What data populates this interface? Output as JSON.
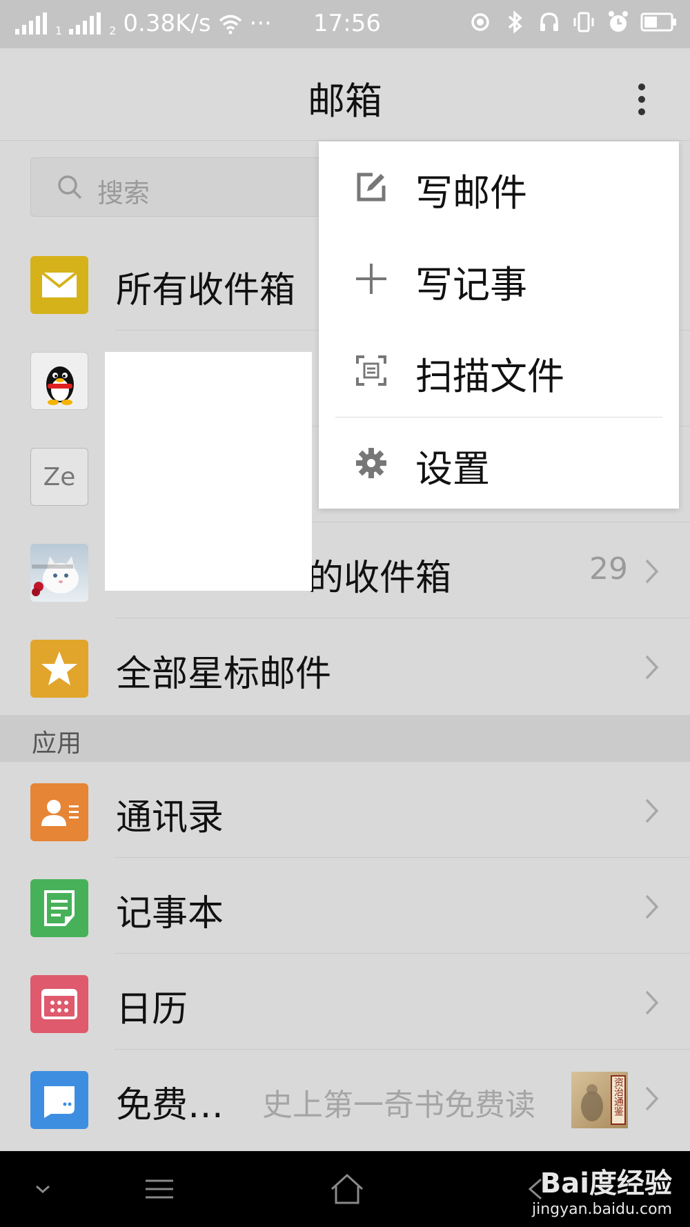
{
  "status_bar": {
    "sim1": "1",
    "sim2": "2",
    "speed": "0.38K/s",
    "dots": "···",
    "time": "17:56"
  },
  "header": {
    "title": "邮箱"
  },
  "search": {
    "placeholder": "搜索"
  },
  "mailboxes": [
    {
      "label": "所有收件箱",
      "icon": "mail-icon",
      "color": "#d6b21a"
    },
    {
      "label": "",
      "icon": "qq-penguin-avatar"
    },
    {
      "label": "",
      "icon": "ze-avatar",
      "icon_text": "Ze"
    },
    {
      "label": "的收件箱",
      "icon": "kitten-avatar",
      "count": "29"
    },
    {
      "label": "全部星标邮件",
      "icon": "star-icon",
      "color": "#e2a52c"
    }
  ],
  "section": {
    "title": "应用"
  },
  "apps": [
    {
      "label": "通讯录",
      "icon": "contacts-icon",
      "color": "#e68535"
    },
    {
      "label": "记事本",
      "icon": "notepad-icon",
      "color": "#47b15a"
    },
    {
      "label": "日历",
      "icon": "calendar-icon",
      "color": "#de5a6c"
    },
    {
      "label": "免费…",
      "icon": "reading-icon",
      "color": "#3d8ee0",
      "promo": "史上第一奇书免费读",
      "thumb_text": "资治通鉴"
    }
  ],
  "menu": {
    "items": [
      {
        "label": "写邮件",
        "icon": "compose-icon"
      },
      {
        "label": "写记事",
        "icon": "plus-icon"
      },
      {
        "label": "扫描文件",
        "icon": "scan-icon"
      },
      {
        "label": "设置",
        "icon": "gear-icon"
      }
    ]
  },
  "watermark": {
    "line1": "Bai度经验",
    "line2": "jingyan.baidu.com"
  }
}
